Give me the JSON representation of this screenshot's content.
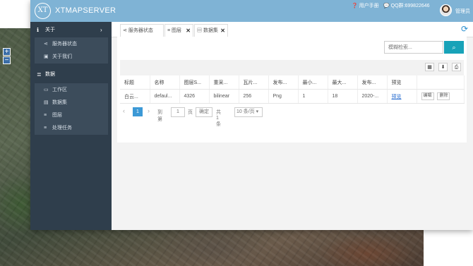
{
  "map": {
    "zoom_in": "+",
    "zoom_out": "−"
  },
  "header": {
    "logo_text": "XT",
    "brand": "XTMAPSERVER",
    "manual": "用户手册",
    "qq": "QQ群:699822646",
    "user": "管理员"
  },
  "sidebar": {
    "sections": [
      {
        "label": "关于",
        "items": [
          "服务器状态",
          "关于我们"
        ]
      },
      {
        "label": "数据",
        "items": [
          "工作区",
          "数据集",
          "图层",
          "处理任务"
        ]
      }
    ]
  },
  "tabs": [
    {
      "label": "服务器状态"
    },
    {
      "label": "图层"
    },
    {
      "label": "数据集"
    }
  ],
  "search": {
    "placeholder": "模糊检索..."
  },
  "table": {
    "columns": [
      "标题",
      "名称",
      "图层S...",
      "重采...",
      "瓦片...",
      "发布...",
      "最小...",
      "最大...",
      "发布...",
      "预览",
      ""
    ],
    "rows": [
      {
        "cells": [
          "白云...",
          "defaul...",
          "4326",
          "bilinear",
          "256",
          "Png",
          "1",
          "18",
          "2020-..."
        ],
        "preview": "预览",
        "edit": "编辑",
        "delete": "删除"
      }
    ]
  },
  "pager": {
    "current": "1",
    "goto_label": "到第",
    "goto_value": "1",
    "page_unit": "页",
    "confirm": "确定",
    "total": "共 1 条",
    "page_size": "10 条/页"
  }
}
